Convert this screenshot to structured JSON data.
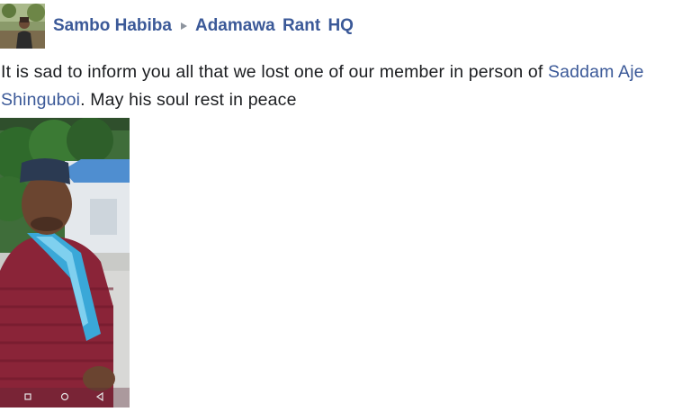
{
  "post": {
    "author": "Sambo Habiba",
    "group": "Adamawa Rant HQ",
    "message_part1": "It is sad to inform you all that we lost one of our member in person of ",
    "mention": "Saddam Aje Shinguboi",
    "message_part2": ". May his soul rest in peace"
  },
  "icons": {
    "separator": "triangle-right-icon"
  },
  "colors": {
    "link": "#3b5998",
    "text": "#1c1e21"
  }
}
